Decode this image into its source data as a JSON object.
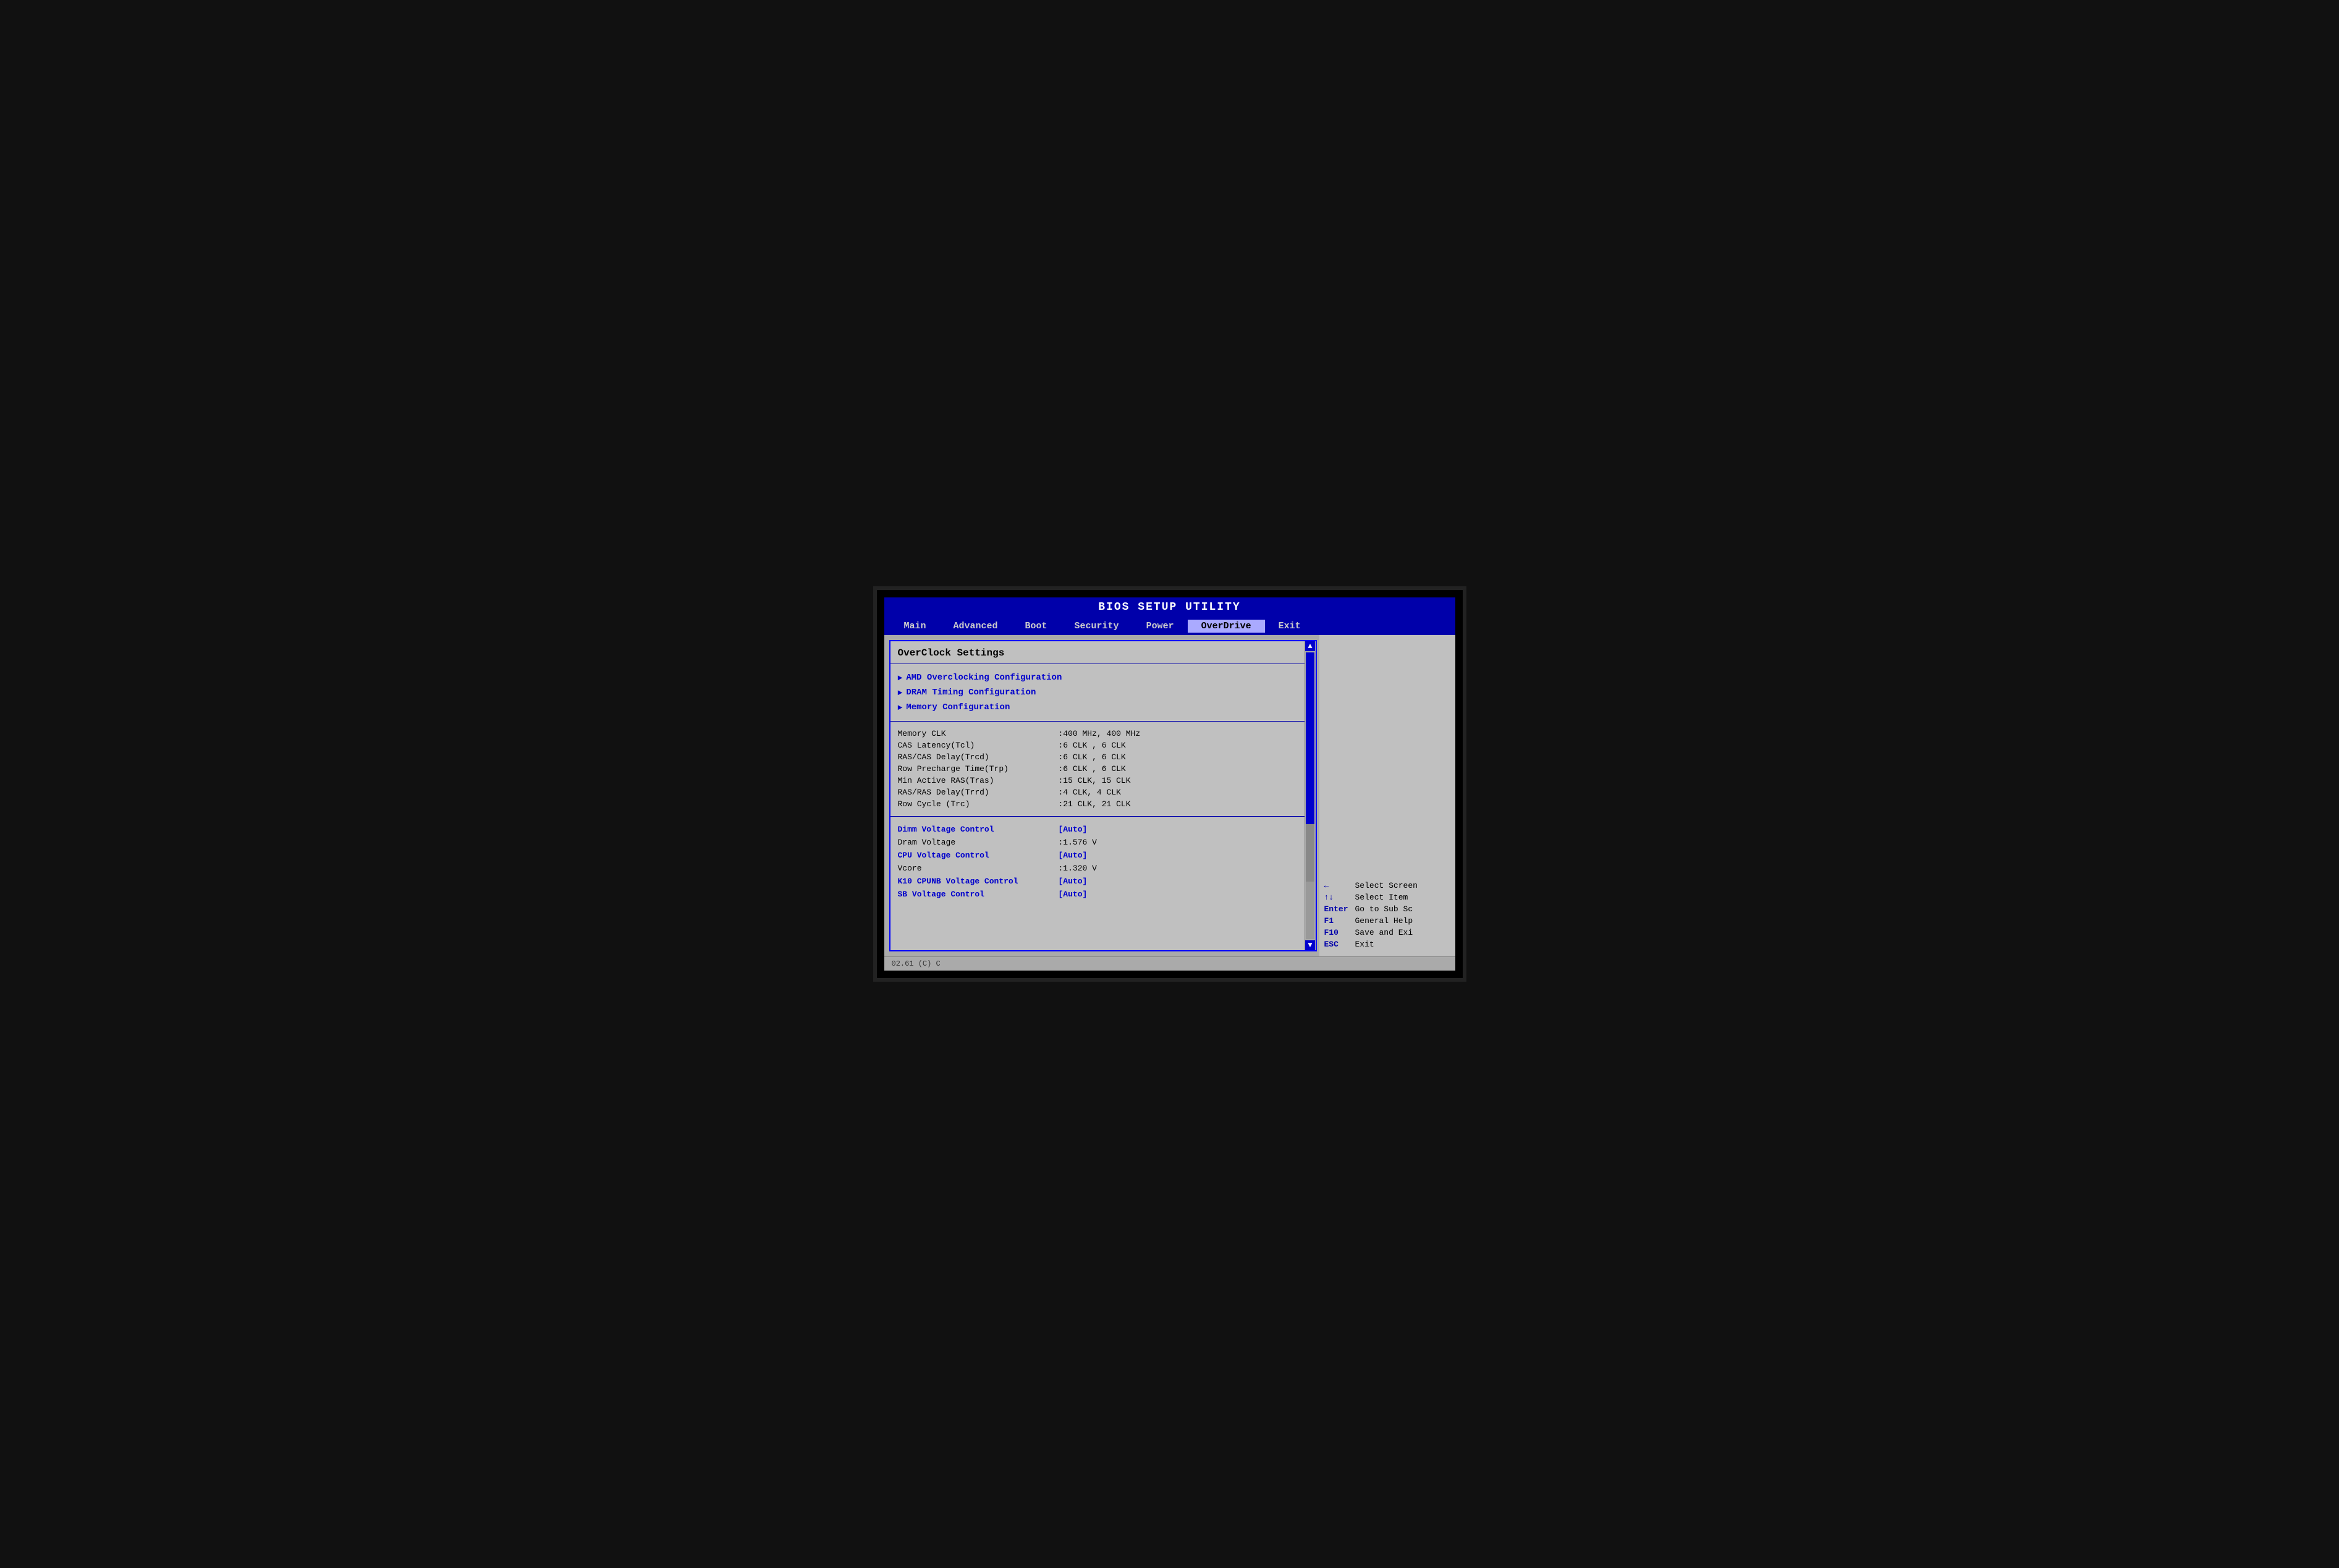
{
  "title": "BIOS SETUP UTILITY",
  "nav": {
    "items": [
      {
        "label": "Main",
        "active": false
      },
      {
        "label": "Advanced",
        "active": false
      },
      {
        "label": "Boot",
        "active": false
      },
      {
        "label": "Security",
        "active": false
      },
      {
        "label": "Power",
        "active": false
      },
      {
        "label": "OverDrive",
        "active": true
      },
      {
        "label": "Exit",
        "active": false
      }
    ]
  },
  "panel": {
    "title": "OverClock Settings",
    "submenus": [
      {
        "label": "AMD Overclocking Configuration"
      },
      {
        "label": "DRAM Timing Configuration"
      },
      {
        "label": "Memory Configuration"
      }
    ],
    "info_rows": [
      {
        "label": "Memory CLK",
        "value": ":400 MHz, 400 MHz"
      },
      {
        "label": "CAS Latency(Tcl)",
        "value": ":6 CLK , 6 CLK"
      },
      {
        "label": "RAS/CAS Delay(Trcd)",
        "value": ":6 CLK , 6 CLK"
      },
      {
        "label": "Row Precharge Time(Trp)",
        "value": ":6 CLK , 6 CLK"
      },
      {
        "label": "Min Active RAS(Tras)",
        "value": ":15 CLK, 15 CLK"
      },
      {
        "label": "RAS/RAS Delay(Trrd)",
        "value": ":4 CLK, 4 CLK"
      },
      {
        "label": "Row Cycle (Trc)",
        "value": ":21 CLK, 21 CLK"
      }
    ],
    "control_rows": [
      {
        "label": "Dimm Voltage Control",
        "value": "[Auto]",
        "label_blue": true,
        "value_blue": true
      },
      {
        "label": "Dram Voltage",
        "value": ":1.576 V",
        "label_blue": false,
        "value_blue": false
      },
      {
        "label": "CPU Voltage Control",
        "value": "[Auto]",
        "label_blue": true,
        "value_blue": true
      },
      {
        "label": "Vcore",
        "value": ":1.320 V",
        "label_blue": false,
        "value_blue": false
      },
      {
        "label": "K10 CPUNB Voltage Control",
        "value": "[Auto]",
        "label_blue": true,
        "value_blue": true
      },
      {
        "label": "SB Voltage Control",
        "value": "[Auto]",
        "label_blue": true,
        "value_blue": true
      }
    ]
  },
  "help": {
    "rows": [
      {
        "key": "←",
        "desc": "Select Screen"
      },
      {
        "key": "↑↓",
        "desc": "Select Item"
      },
      {
        "key": "Enter",
        "desc": "Go to Sub Sc"
      },
      {
        "key": "F1",
        "desc": "General Help"
      },
      {
        "key": "F10",
        "desc": "Save and Exi"
      },
      {
        "key": "ESC",
        "desc": "Exit"
      }
    ]
  },
  "bottom_bar": "02.61 (C) C"
}
